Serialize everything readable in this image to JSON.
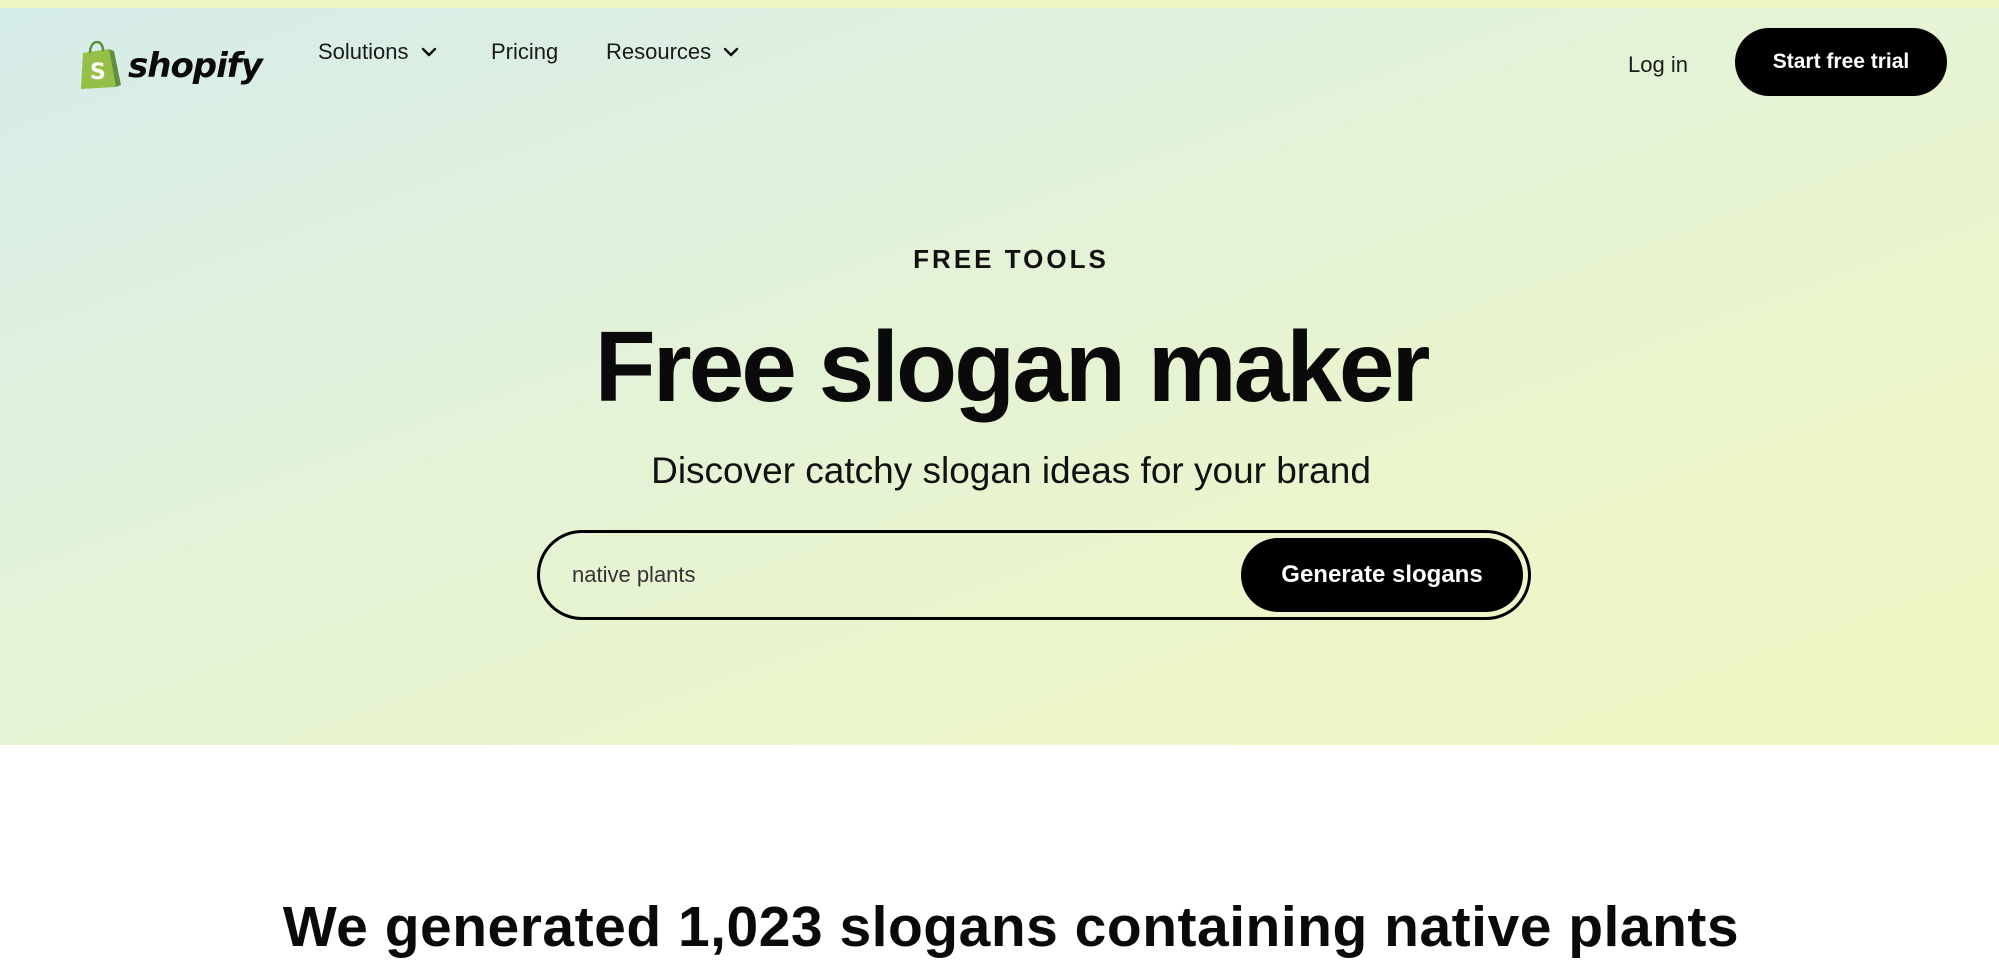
{
  "brand": {
    "name": "shopify",
    "logo_icon": "shopping-bag-icon",
    "logo_color": "#95bf47"
  },
  "nav": {
    "solutions": "Solutions",
    "pricing": "Pricing",
    "resources": "Resources",
    "chevron_icon": "chevron-down-icon"
  },
  "header": {
    "login": "Log in",
    "trial_button": "Start free trial"
  },
  "hero": {
    "eyebrow": "FREE TOOLS",
    "title": "Free slogan maker",
    "subtitle": "Discover catchy slogan ideas for your brand",
    "search_value": "native plants",
    "generate_button": "Generate slogans",
    "background_from": "#d6ecea",
    "background_to": "#eef7c2"
  },
  "results": {
    "title": "We generated 1,023 slogans containing native plants"
  },
  "colors": {
    "button_bg": "#000000",
    "button_text": "#ffffff"
  }
}
